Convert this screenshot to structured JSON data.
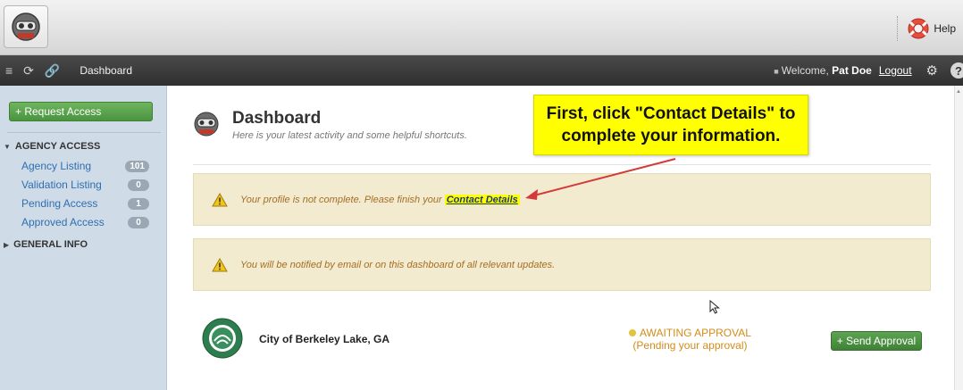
{
  "header": {
    "help_label": "Help"
  },
  "nav": {
    "title": "Dashboard",
    "welcome_prefix": "Welcome, ",
    "user_name": "Pat Doe",
    "logout_label": "Logout"
  },
  "sidebar": {
    "request_button": "+ Request Access",
    "sections": [
      {
        "title": "AGENCY ACCESS",
        "expanded": true
      },
      {
        "title": "GENERAL INFO",
        "expanded": false
      }
    ],
    "items": [
      {
        "label": "Agency Listing",
        "count": "101"
      },
      {
        "label": "Validation Listing",
        "count": "0"
      },
      {
        "label": "Pending Access",
        "count": "1"
      },
      {
        "label": "Approved Access",
        "count": "0"
      }
    ]
  },
  "main": {
    "title": "Dashboard",
    "subtitle": "Here is your latest activity and some helpful shortcuts.",
    "callout_line1": "First, click \"Contact Details\" to",
    "callout_line2": "complete your information.",
    "alert1_text": "Your profile is not complete. Please finish your ",
    "alert1_link": "Contact Details",
    "alert2_text": "You will be notified by email or on this dashboard of all relevant updates.",
    "org": {
      "name": "City of Berkeley Lake, GA",
      "status_line1": "AWAITING APPROVAL",
      "status_line2": "(Pending your approval)",
      "send_button": "+ Send Approval"
    }
  },
  "colors": {
    "accent_green": "#4a9440",
    "highlight_yellow": "#ffff00",
    "alert_bg": "#f2ebcf",
    "sidebar_bg": "#cfdbe7",
    "annotation_arrow": "#d43a3a"
  }
}
